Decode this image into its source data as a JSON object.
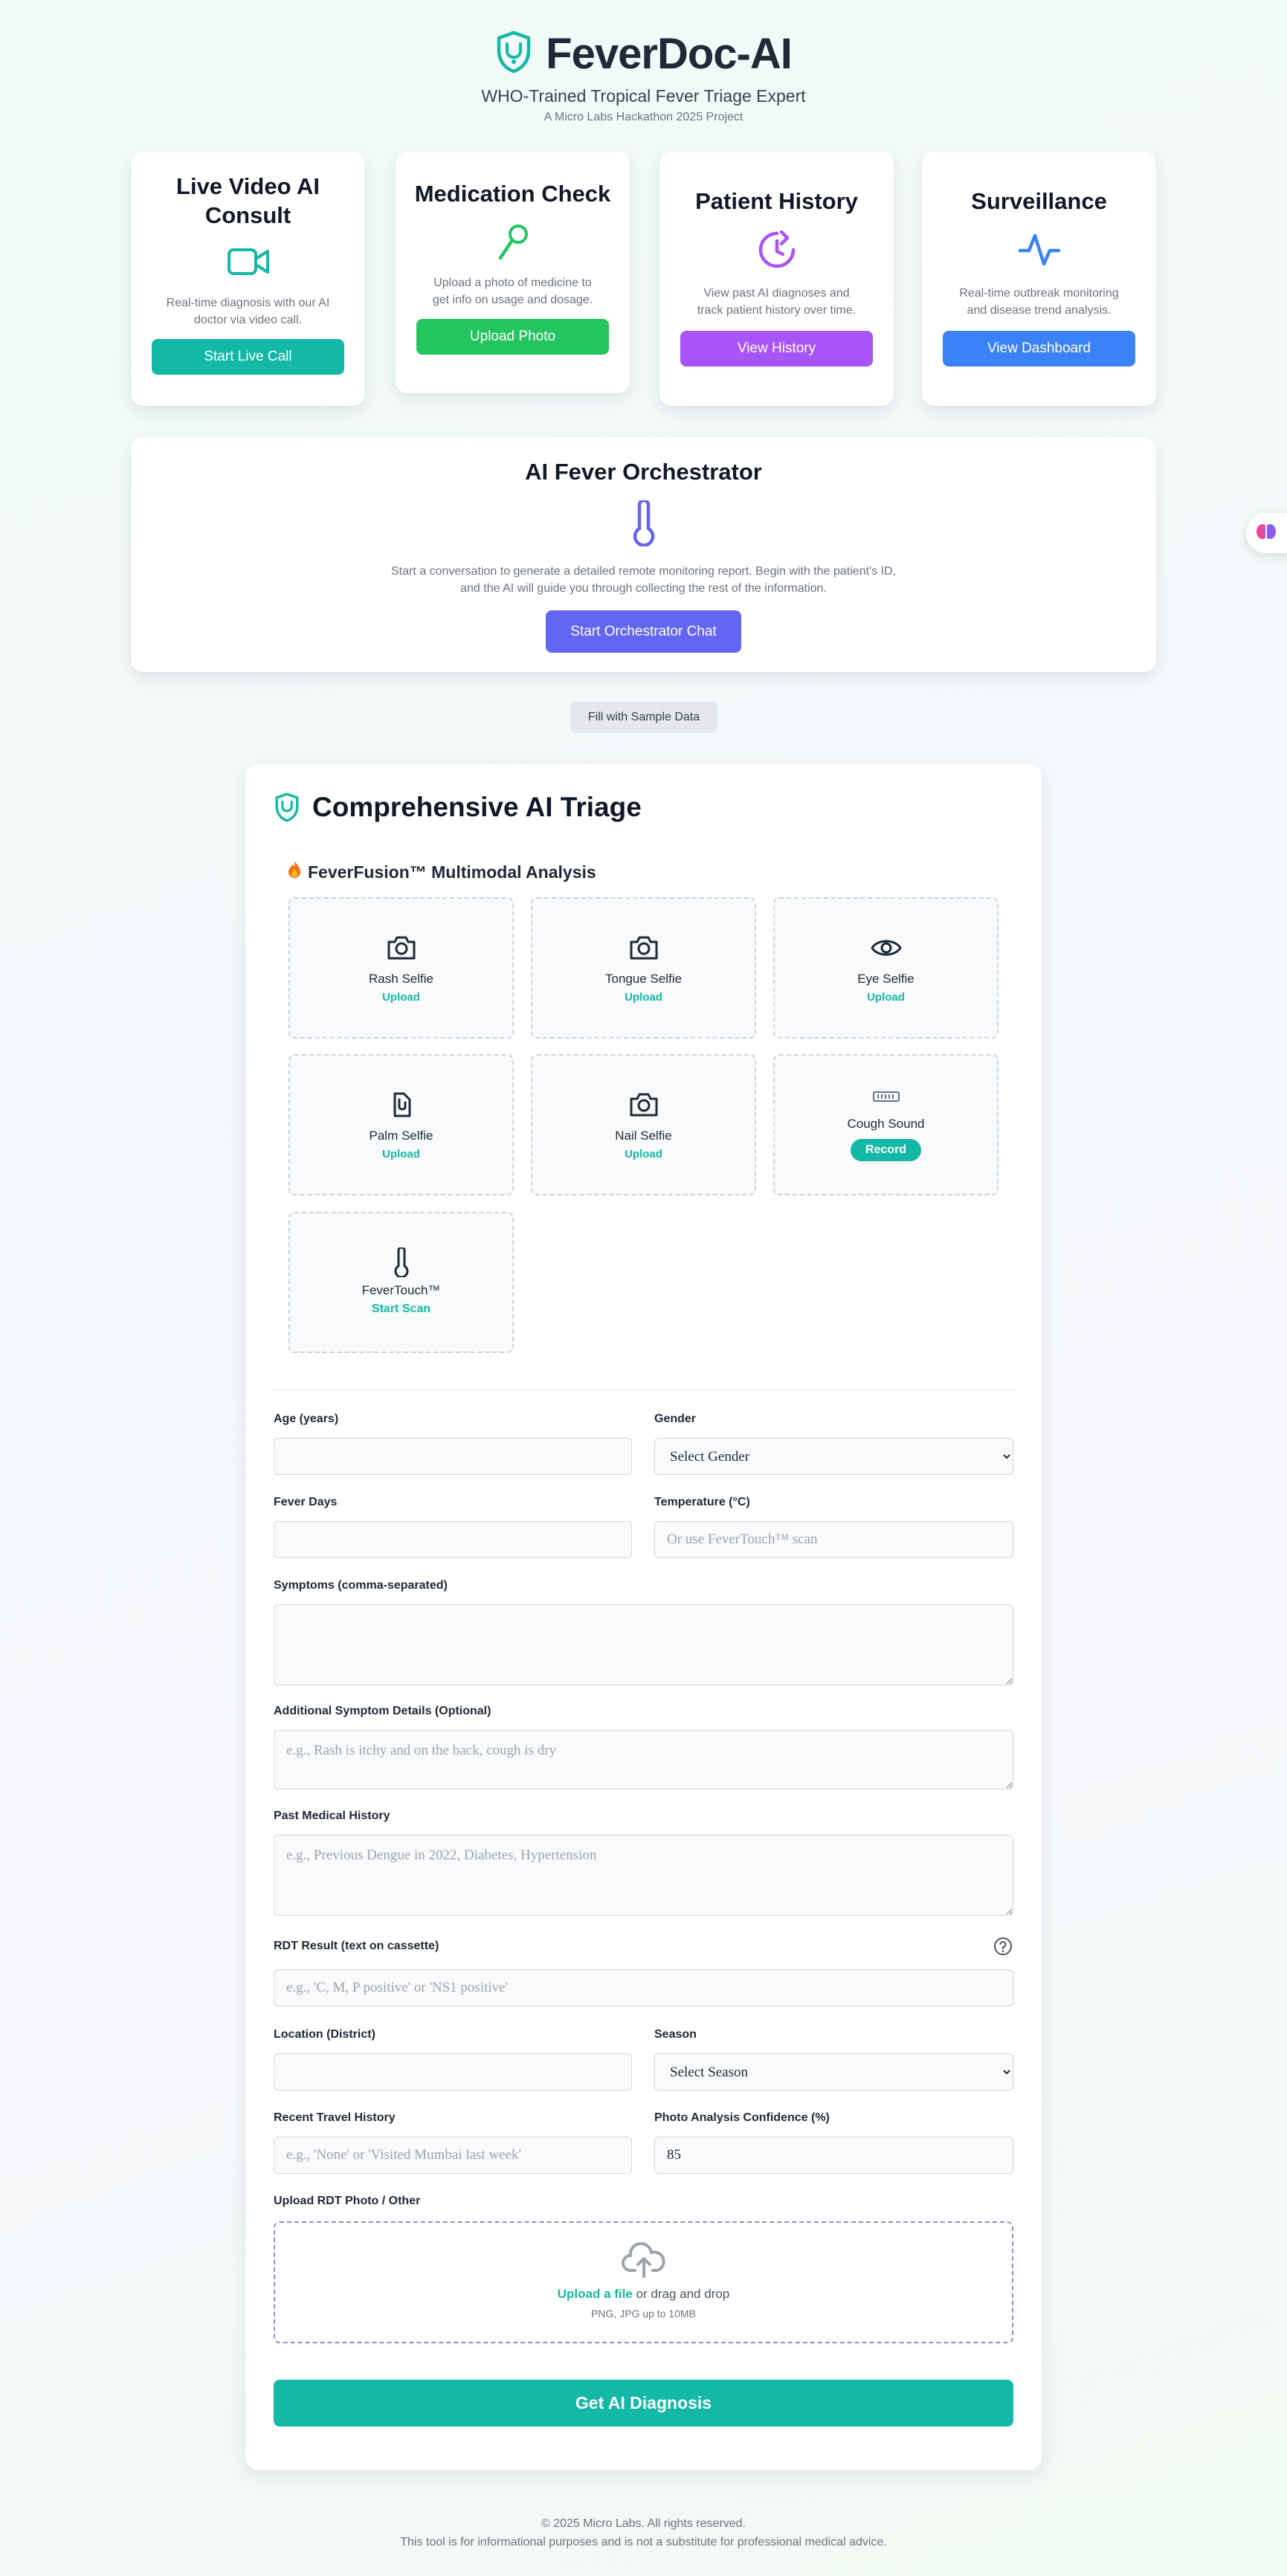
{
  "header": {
    "title": "FeverDoc-AI",
    "subtitle": "WHO-Trained Tropical Fever Triage Expert",
    "tagline": "A Micro Labs Hackathon 2025 Project"
  },
  "cards": [
    {
      "title": "Live Video AI Consult",
      "description": "Real-time diagnosis with our AI doctor via video call.",
      "button": "Start Live Call",
      "color": "#14b8a6",
      "icon": "video-camera-icon"
    },
    {
      "title": "Medication Check",
      "description": "Upload a photo of medicine to get info on usage and dosage.",
      "button": "Upload Photo",
      "color": "#22c55e",
      "icon": "pill-magnifier-icon"
    },
    {
      "title": "Patient History",
      "description": "View past AI diagnoses and track patient history over time.",
      "button": "View History",
      "color": "#a855f7",
      "icon": "history-clock-icon"
    },
    {
      "title": "Surveillance",
      "description": "Real-time outbreak monitoring and disease trend analysis.",
      "button": "View Dashboard",
      "color": "#3b82f6",
      "icon": "activity-pulse-icon"
    }
  ],
  "orchestrator": {
    "title": "AI Fever Orchestrator",
    "description": "Start a conversation to generate a detailed remote monitoring report. Begin with the patient's ID, and the AI will guide you through collecting the rest of the information.",
    "button": "Start Orchestrator Chat",
    "color": "#6366f1",
    "icon": "thermometer-icon"
  },
  "sample_button": "Fill with Sample Data",
  "triage": {
    "title": "Comprehensive AI Triage",
    "fusion_title": "FeverFusion™ Multimodal Analysis",
    "tiles": [
      {
        "label": "Rash Selfie",
        "action": "Upload",
        "icon": "camera-icon"
      },
      {
        "label": "Tongue Selfie",
        "action": "Upload",
        "icon": "camera-icon"
      },
      {
        "label": "Eye Selfie",
        "action": "Upload",
        "icon": "eye-icon"
      },
      {
        "label": "Palm Selfie",
        "action": "Upload",
        "icon": "hand-icon"
      },
      {
        "label": "Nail Selfie",
        "action": "Upload",
        "icon": "camera-icon"
      },
      {
        "label": "Cough Sound",
        "action": "Record",
        "icon": "waveform-icon"
      },
      {
        "label": "FeverTouch™",
        "action": "Start Scan",
        "icon": "thermometer-icon"
      }
    ],
    "fields": {
      "age": {
        "label": "Age (years)",
        "value": "",
        "placeholder": ""
      },
      "gender": {
        "label": "Gender",
        "value": "Select Gender"
      },
      "fever_days": {
        "label": "Fever Days",
        "value": "",
        "placeholder": ""
      },
      "temperature": {
        "label": "Temperature (°C)",
        "placeholder": "Or use FeverTouch™ scan"
      },
      "symptoms": {
        "label": "Symptoms (comma-separated)",
        "placeholder": ""
      },
      "details": {
        "label": "Additional Symptom Details (Optional)",
        "placeholder": "e.g., Rash is itchy and on the back, cough is dry"
      },
      "history": {
        "label": "Past Medical History",
        "placeholder": "e.g., Previous Dengue in 2022, Diabetes, Hypertension"
      },
      "rdt": {
        "label": "RDT Result (text on cassette)",
        "placeholder": "e.g., 'C, M, P positive' or 'NS1 positive'"
      },
      "location": {
        "label": "Location (District)",
        "placeholder": ""
      },
      "season": {
        "label": "Season",
        "value": "Select Season"
      },
      "travel": {
        "label": "Recent Travel History",
        "placeholder": "e.g., 'None' or 'Visited Mumbai last week'"
      },
      "confidence": {
        "label": "Photo Analysis Confidence (%)",
        "value": "85"
      }
    },
    "upload": {
      "label": "Upload RDT Photo / Other",
      "link": "Upload a file",
      "text": "or drag and drop",
      "hint": "PNG, JPG up to 10MB"
    },
    "submit": "Get AI Diagnosis"
  },
  "footer": {
    "copyright": "© 2025 Micro Labs. All rights reserved.",
    "disclaimer": "This tool is for informational purposes and is not a substitute for professional medical advice."
  },
  "colors": {
    "teal": "#14b8a6",
    "indigo": "#6366f1",
    "dark": "#1f2937"
  }
}
